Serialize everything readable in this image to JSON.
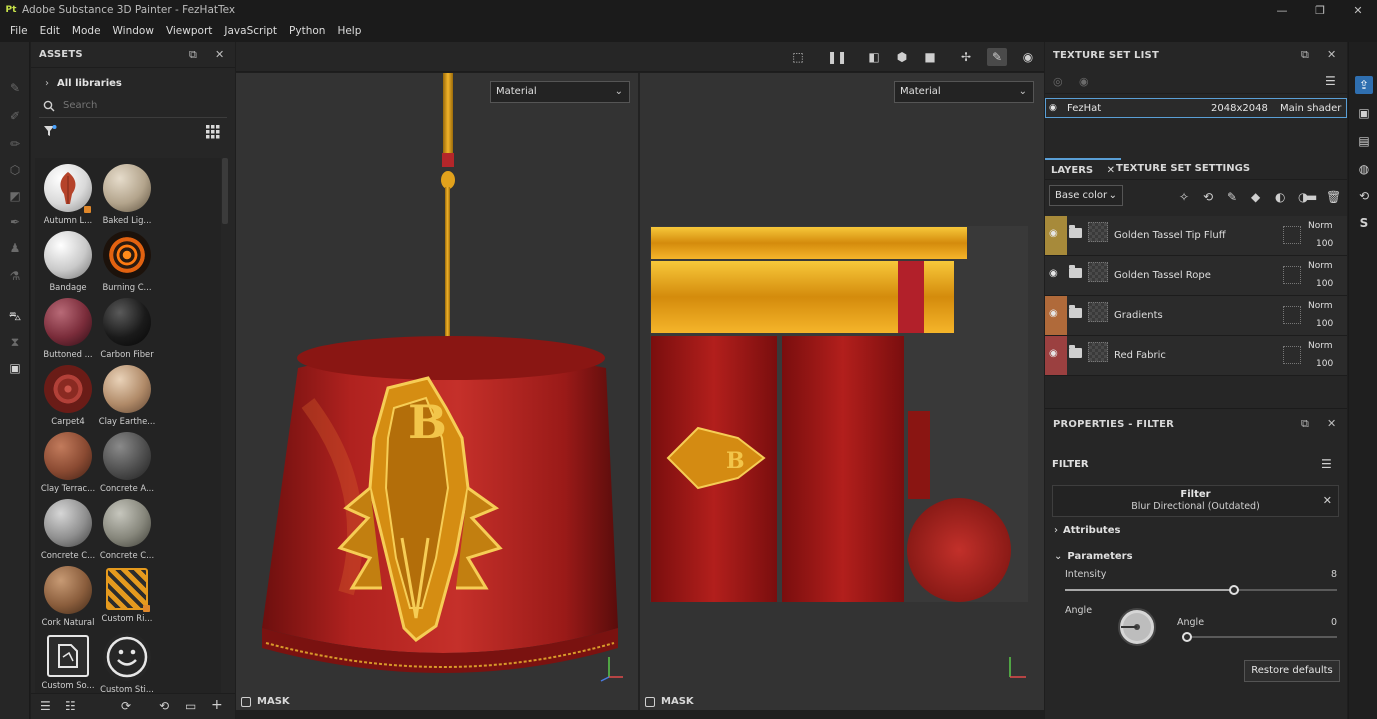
{
  "window": {
    "app_logo": "Pt",
    "title": "Adobe Substance 3D Painter - FezHatTex",
    "controls": [
      "—",
      "❐",
      "✕"
    ]
  },
  "menu": [
    "File",
    "Edit",
    "Mode",
    "Window",
    "Viewport",
    "JavaScript",
    "Python",
    "Help"
  ],
  "assets": {
    "title": "ASSETS",
    "library": "All libraries",
    "search_placeholder": "Search",
    "items": [
      {
        "label": "Autumn L...",
        "icon": "leaf-sphere"
      },
      {
        "label": "Baked Lig...",
        "icon": "sphere"
      },
      {
        "label": "Bandage",
        "icon": "sphere"
      },
      {
        "label": "Burning C...",
        "icon": "sphere"
      },
      {
        "label": "Buttoned ...",
        "icon": "sphere"
      },
      {
        "label": "Carbon Fiber",
        "icon": "sphere"
      },
      {
        "label": "Carpet4",
        "icon": "sphere"
      },
      {
        "label": "Clay Earthe...",
        "icon": "sphere"
      },
      {
        "label": "Clay Terrac...",
        "icon": "sphere"
      },
      {
        "label": "Concrete A...",
        "icon": "sphere"
      },
      {
        "label": "Concrete C...",
        "icon": "sphere"
      },
      {
        "label": "Concrete C...",
        "icon": "sphere"
      },
      {
        "label": "Cork Natural",
        "icon": "sphere"
      },
      {
        "label": "Custom Ri...",
        "icon": "stripe-tile"
      },
      {
        "label": "Custom So...",
        "icon": "paper-tile"
      },
      {
        "label": "Custom Sti...",
        "icon": "smiley-tile"
      }
    ]
  },
  "viewport": {
    "left_mode": "Material",
    "right_mode": "Material",
    "mask_label_left": "MASK",
    "mask_label_right": "MASK"
  },
  "texture_set_list": {
    "title": "TEXTURE SET LIST",
    "row": {
      "name": "FezHat",
      "size": "2048x2048",
      "shader": "Main shader"
    }
  },
  "layers": {
    "tab_layers": "LAYERS",
    "tab_settings": "TEXTURE SET SETTINGS",
    "channel": "Base color",
    "items": [
      {
        "name": "Golden Tassel Tip Fluff",
        "blend": "Norm",
        "opacity": "100",
        "color": "#a78a3a"
      },
      {
        "name": "Golden Tassel Rope",
        "blend": "Norm",
        "opacity": "100",
        "color": "#2b2b2b"
      },
      {
        "name": "Gradients",
        "blend": "Norm",
        "opacity": "100",
        "color": "#b06a3a"
      },
      {
        "name": "Red Fabric",
        "blend": "Norm",
        "opacity": "100",
        "color": "#9b4040"
      }
    ]
  },
  "properties": {
    "title": "PROPERTIES - FILTER",
    "section": "FILTER",
    "filter_name": "Filter",
    "filter_sub": "Blur Directional (Outdated)",
    "attributes": "Attributes",
    "parameters": "Parameters",
    "intensity_label": "Intensity",
    "intensity_value": "8",
    "intensity_fraction": 0.62,
    "angle_group_label": "Angle",
    "angle_label": "Angle",
    "angle_value": "0",
    "angle_fraction": 0.0,
    "restore": "Restore defaults"
  },
  "colors": {
    "accent": "#2f6fb0",
    "selection": "#5a9fd6",
    "fez_red": "#b0221f",
    "gold": "#e0a21a"
  }
}
